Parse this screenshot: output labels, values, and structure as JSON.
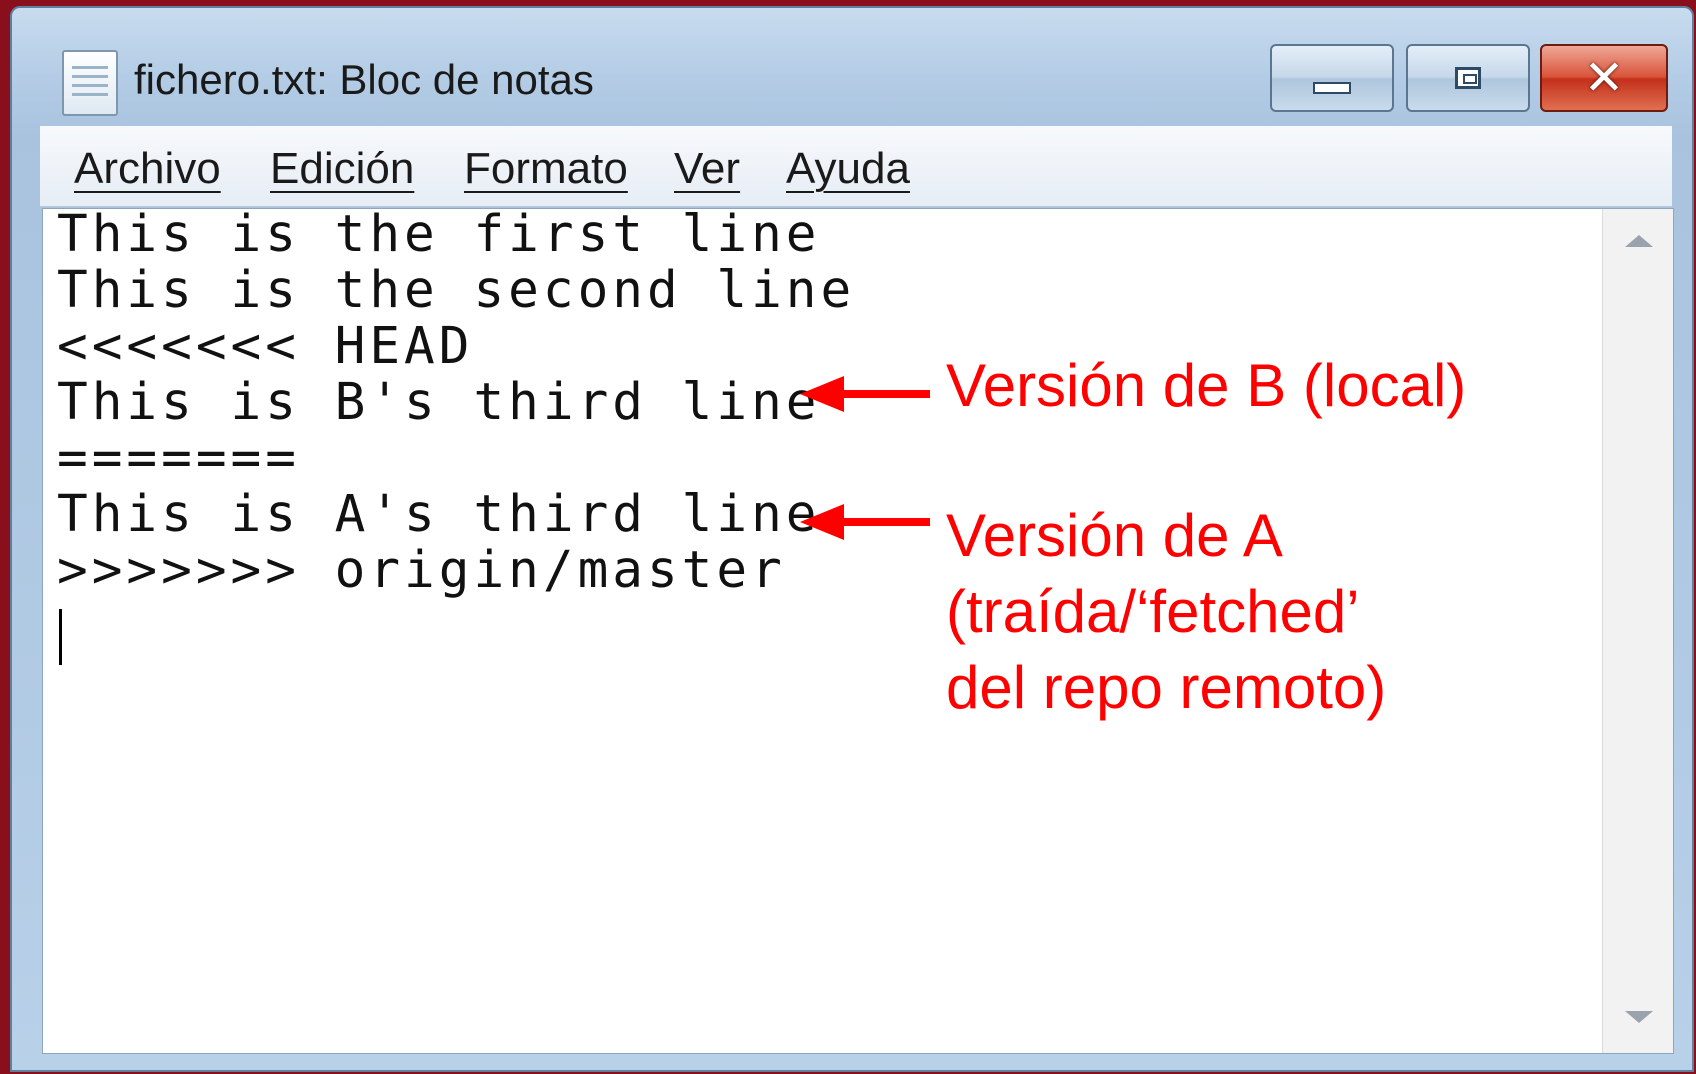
{
  "window": {
    "title": "fichero.txt: Bloc de notas",
    "close_label": "✕"
  },
  "menu": {
    "items": [
      "Archivo",
      "Edición",
      "Formato",
      "Ver",
      "Ayuda"
    ]
  },
  "editor": {
    "lines": [
      "This is the first line",
      "This is the second line",
      "<<<<<<< HEAD",
      "This is B's third line",
      "=======",
      "This is A's third line",
      ">>>>>>> origin/master"
    ]
  },
  "annotations": {
    "color": "#ff0000",
    "version_b": "Versión de B (local)",
    "version_a": [
      "Versión de A",
      "(traída/‘fetched’",
      "del repo remoto)"
    ]
  }
}
